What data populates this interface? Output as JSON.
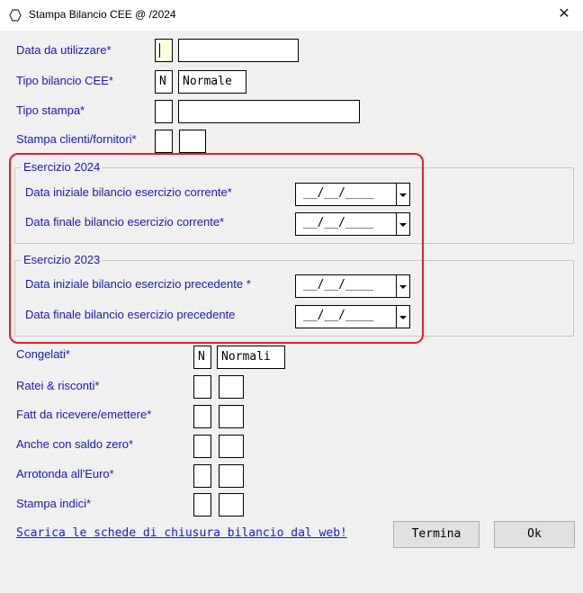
{
  "window": {
    "title": "Stampa Bilancio CEE @                  /2024",
    "close_glyph": "✕"
  },
  "fields": {
    "data_label": "Data da utilizzare*",
    "tipo_label": "Tipo bilancio CEE*",
    "tipo_code": "N",
    "tipo_desc": "Normale",
    "stampa_label": "Tipo stampa*",
    "clienti_label": "Stampa clienti/fornitori*"
  },
  "group_current": {
    "title": "Esercizio 2024",
    "start_label": "Data iniziale bilancio esercizio corrente*",
    "end_label": "Data finale bilancio esercizio corrente*",
    "start_value": "__/__/____",
    "end_value": "__/__/____"
  },
  "group_previous": {
    "title": "Esercizio 2023",
    "start_label": "Data iniziale bilancio esercizio precedente *",
    "end_label": "Data finale bilancio esercizio precedente",
    "start_value": "__/__/____",
    "end_value": "__/__/____"
  },
  "options": {
    "congelati_label": "Congelati*",
    "congelati_code": "N",
    "congelati_desc": "Normali",
    "ratei_label": "Ratei & risconti*",
    "fatt_label": "Fatt da ricevere/emettere*",
    "saldo_label": "Anche con saldo zero*",
    "arrotonda_label": "Arrotonda all'Euro*",
    "indici_label": "Stampa indici*"
  },
  "footer": {
    "link": "Scarica le schede di chiusura bilancio dal web!",
    "termina": "Termina",
    "ok": "Ok"
  },
  "colors": {
    "label": "#1a1aa8",
    "highlight": "#e0202a",
    "link": "#1a1ad0"
  }
}
